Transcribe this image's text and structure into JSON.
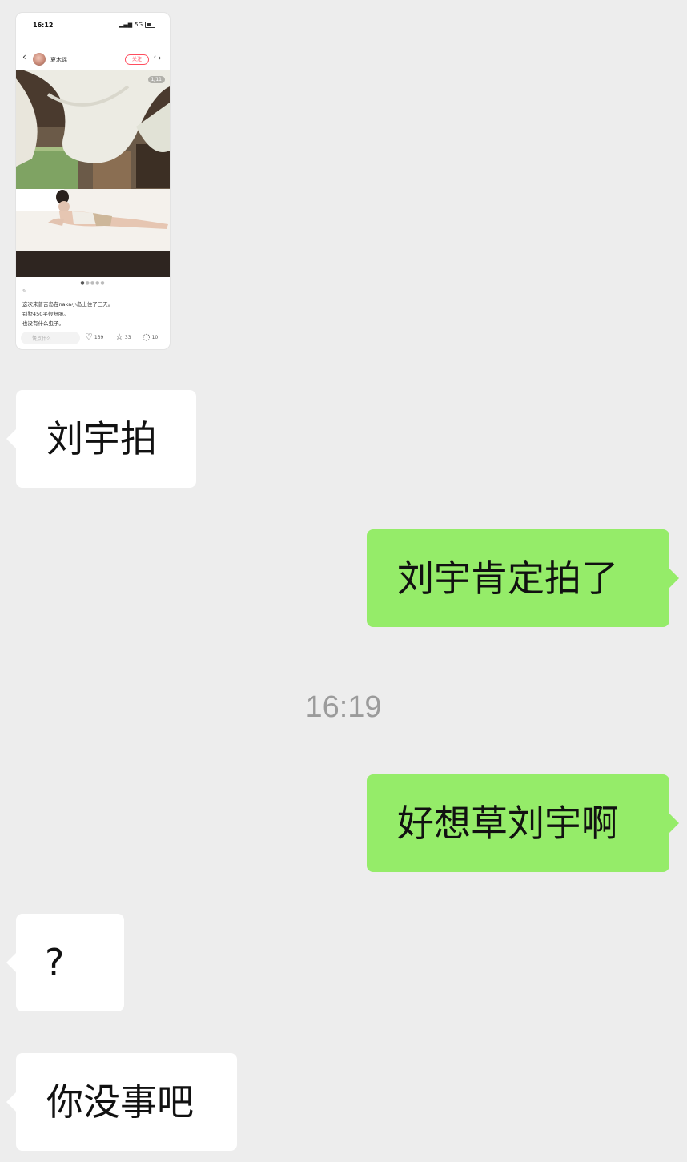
{
  "shared_post": {
    "status_time": "16:12",
    "network": "5G",
    "author": "夏木谣",
    "follow_label": "关注",
    "image_counter": "1/11",
    "caption_lines": [
      "这次来普吉岛在naka小岛上住了三天。",
      "别墅450平很舒服。",
      "也没有什么虫子。"
    ],
    "comment_placeholder": "说点什么…",
    "likes": "139",
    "favorites": "33",
    "comments": "10"
  },
  "messages": [
    {
      "side": "left",
      "text": "刘宇拍"
    },
    {
      "side": "right",
      "text": "刘宇肯定拍了"
    },
    {
      "type": "timestamp",
      "text": "16:19"
    },
    {
      "side": "right",
      "text": "好想草刘宇啊"
    },
    {
      "side": "left",
      "text": "?"
    },
    {
      "side": "left",
      "text": "你没事吧"
    }
  ]
}
